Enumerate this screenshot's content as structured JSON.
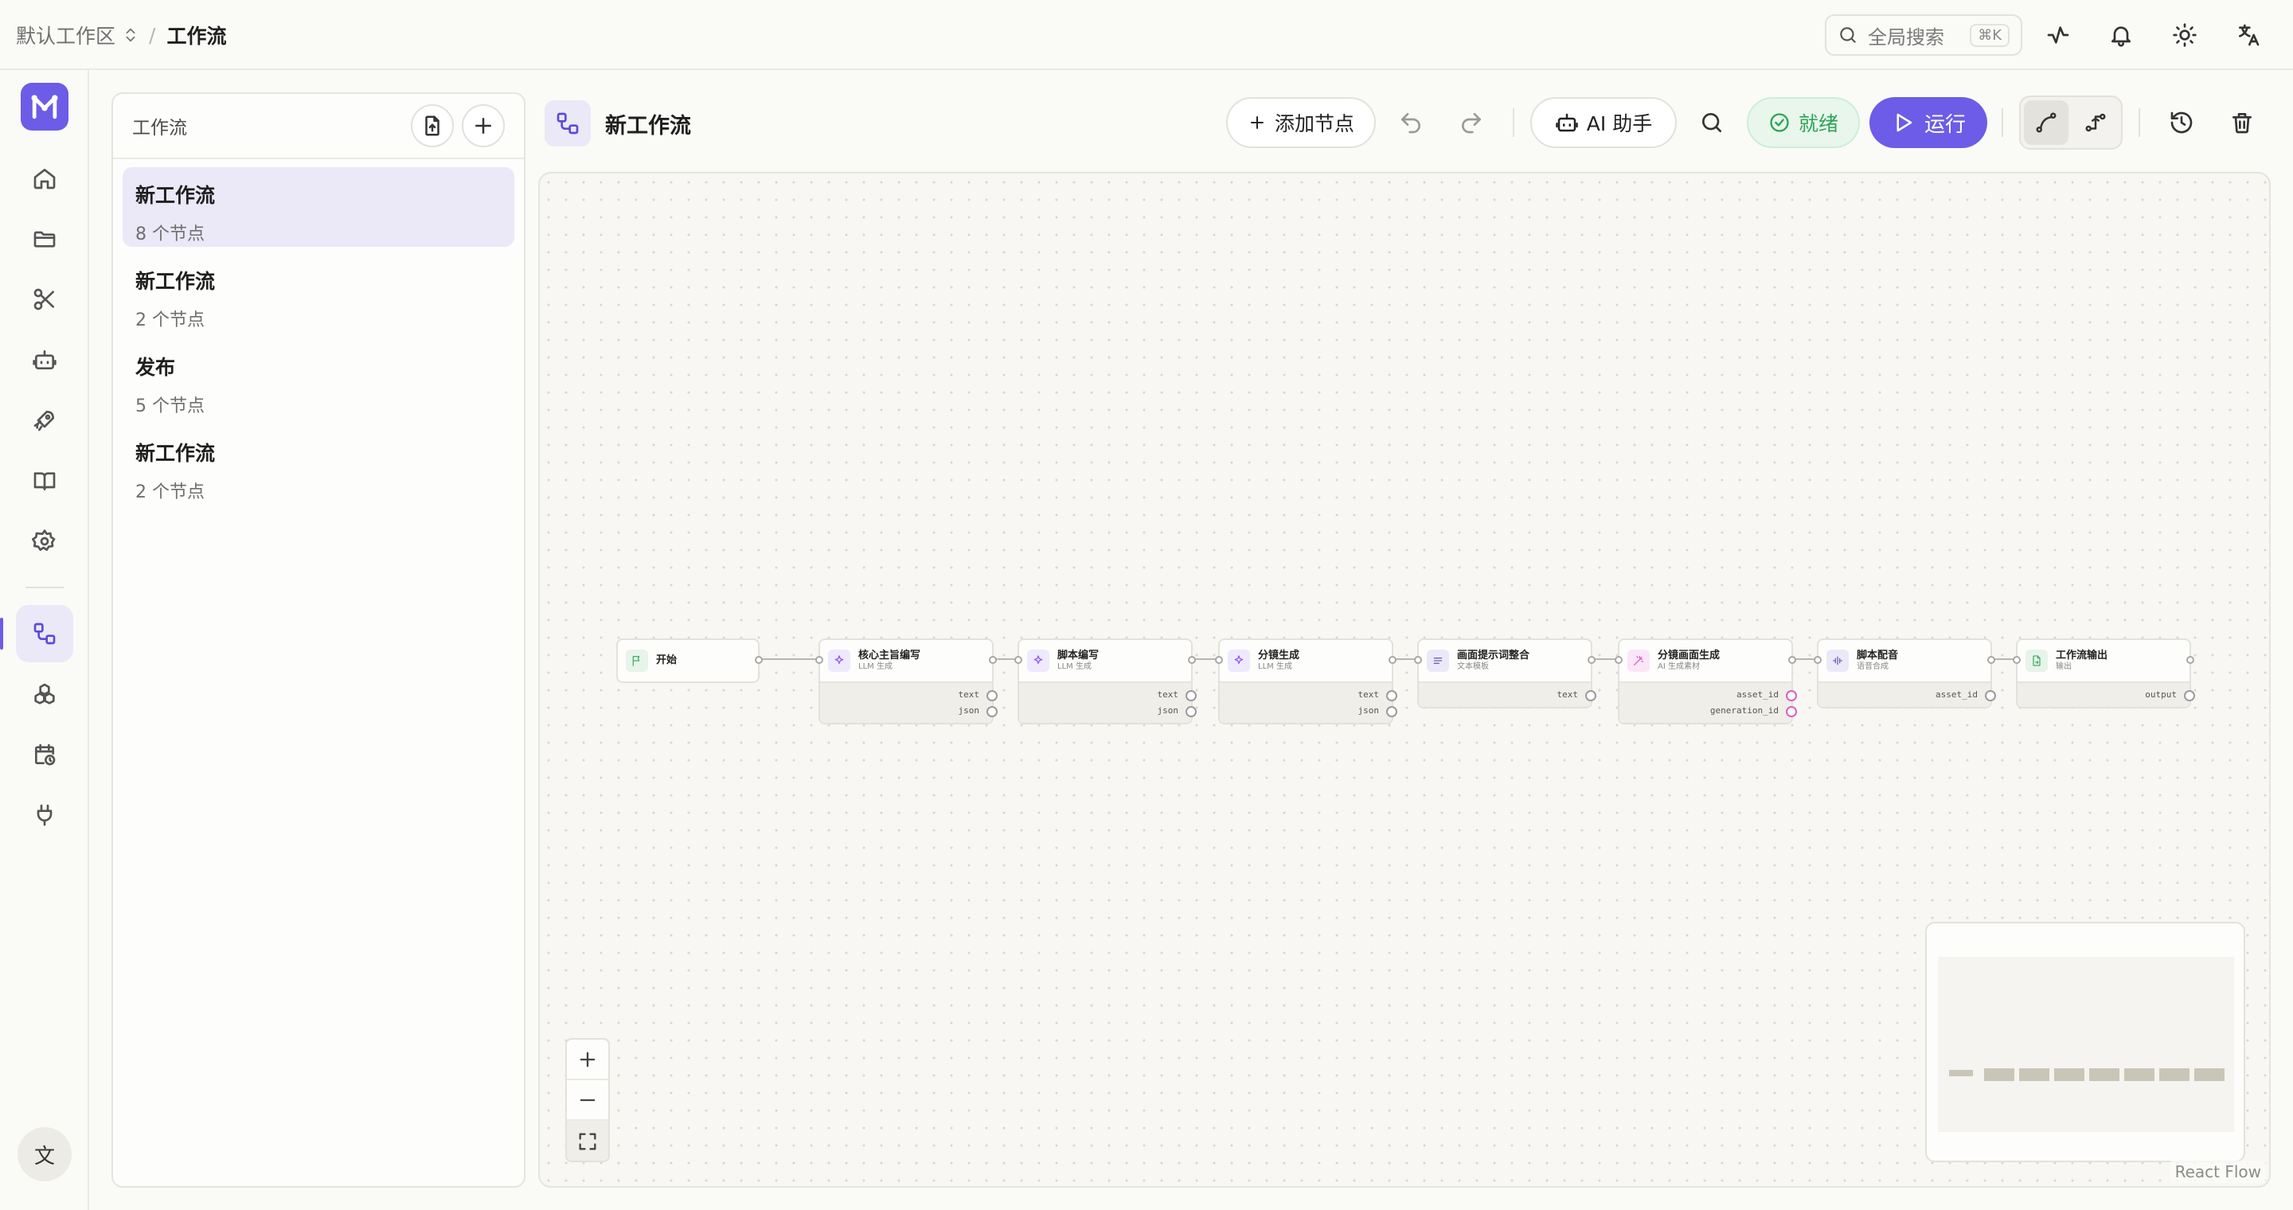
{
  "breadcrumb": {
    "workspace": "默认工作区",
    "separator": "/",
    "current": "工作流"
  },
  "search": {
    "placeholder": "全局搜索",
    "shortcut": "⌘K"
  },
  "topbar_icons": [
    "activity-icon",
    "bell-icon",
    "sun-icon",
    "translate-icon"
  ],
  "rail": {
    "items": [
      "home-icon",
      "folder-icon",
      "scissors-icon",
      "bot-icon",
      "rocket-icon",
      "book-icon",
      "settings-icon",
      "workflow-icon",
      "cubes-icon",
      "calendar-clock-icon",
      "plug-icon"
    ],
    "active": "workflow-icon",
    "lang_label": "文"
  },
  "panel": {
    "title": "工作流",
    "workflows": [
      {
        "name": "新工作流",
        "meta": "8 个节点",
        "active": true
      },
      {
        "name": "新工作流",
        "meta": "2 个节点",
        "active": false
      },
      {
        "name": "发布",
        "meta": "5 个节点",
        "active": false
      },
      {
        "name": "新工作流",
        "meta": "2 个节点",
        "active": false
      }
    ]
  },
  "editor": {
    "title": "新工作流",
    "add_node_label": "添加节点",
    "ai_assistant_label": "AI 助手",
    "status_label": "就绪",
    "run_label": "运行"
  },
  "canvas": {
    "nodes": [
      {
        "name": "开始",
        "sub": "",
        "kind": "start",
        "ports": []
      },
      {
        "name": "核心主旨编写",
        "sub": "LLM 生成",
        "kind": "llm",
        "ports": [
          "text",
          "json"
        ]
      },
      {
        "name": "脚本编写",
        "sub": "LLM 生成",
        "kind": "llm",
        "ports": [
          "text",
          "json"
        ]
      },
      {
        "name": "分镜生成",
        "sub": "LLM 生成",
        "kind": "llm",
        "ports": [
          "text",
          "json"
        ]
      },
      {
        "name": "画面提示词整合",
        "sub": "文本模板",
        "kind": "template",
        "ports": [
          "text"
        ]
      },
      {
        "name": "分镜画面生成",
        "sub": "AI 生成素材",
        "kind": "asset",
        "ports": [
          "asset_id",
          "generation_id"
        ]
      },
      {
        "name": "脚本配音",
        "sub": "语音合成",
        "kind": "tts",
        "ports": [
          "asset_id"
        ]
      },
      {
        "name": "工作流输出",
        "sub": "输出",
        "kind": "output",
        "ports": [
          "output"
        ]
      }
    ],
    "attribution": "React Flow"
  },
  "colors": {
    "accent": "#6c5ce7",
    "accent_soft": "#ebe8f8",
    "ready_green": "#2fa354",
    "llm_purple": "#8b5cf6",
    "asset_pink": "#d660c8",
    "start_green": "#4caf6a"
  }
}
